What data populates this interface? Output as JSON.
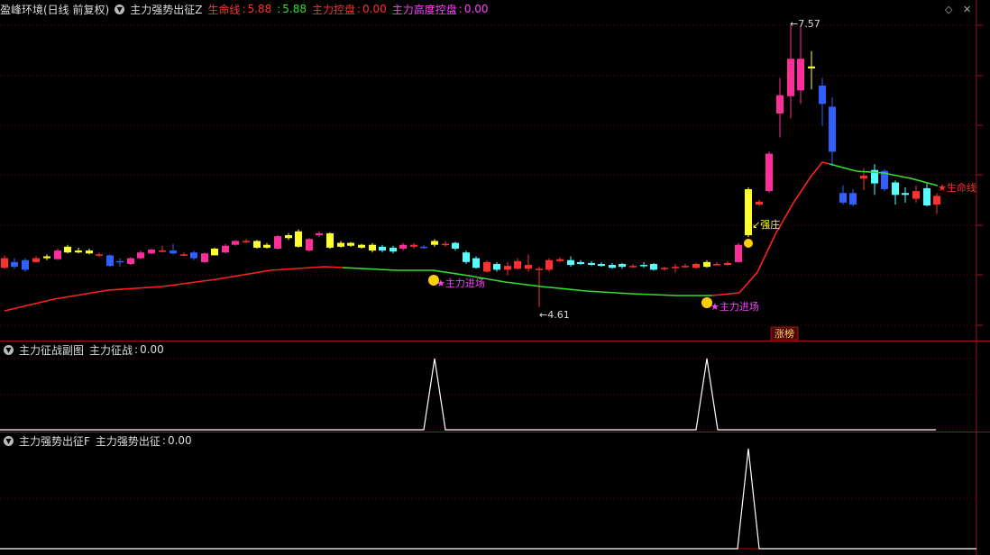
{
  "main_panel": {
    "title": "盈峰环境(日线 前复权)",
    "indicator": "主力强势出征Z",
    "lifeline_label": "生命线",
    "lifeline_value": "5.88",
    "lifeline_value2": "5.88",
    "control_label": "主力控盘",
    "control_value": "0.00",
    "high_control_label": "主力高度控盘",
    "high_control_value": "0.00",
    "annotations": {
      "high_price": "7.57",
      "low_price": "4.61",
      "strong_zhuang": "强庄",
      "main_force_entry_1": "主力进场",
      "main_force_entry_2": "主力进场",
      "lifeline_tag": "生命线",
      "limit_up_list": "涨榜"
    }
  },
  "sub_panel_1": {
    "title": "主力征战副图",
    "value_label": "主力征战",
    "value": "0.00"
  },
  "sub_panel_2": {
    "title": "主力强势出征F",
    "value_label": "主力强势出征",
    "value": "0.00"
  },
  "colors": {
    "up": "#ff3030",
    "down_cyan": "#55ffff",
    "blue": "#3060ff",
    "magenta": "#ff2e9a",
    "yellow": "#ffff30",
    "lifeline_red": "#ff2020",
    "lifeline_green": "#30e030",
    "divider": "#a01010"
  },
  "chart_data": {
    "type": "candlestick",
    "price_annotations": {
      "high": 7.57,
      "low": 4.61
    },
    "sub1_signal_spikes": [
      2,
      2
    ],
    "sub2_signal_spikes": [
      1
    ]
  }
}
